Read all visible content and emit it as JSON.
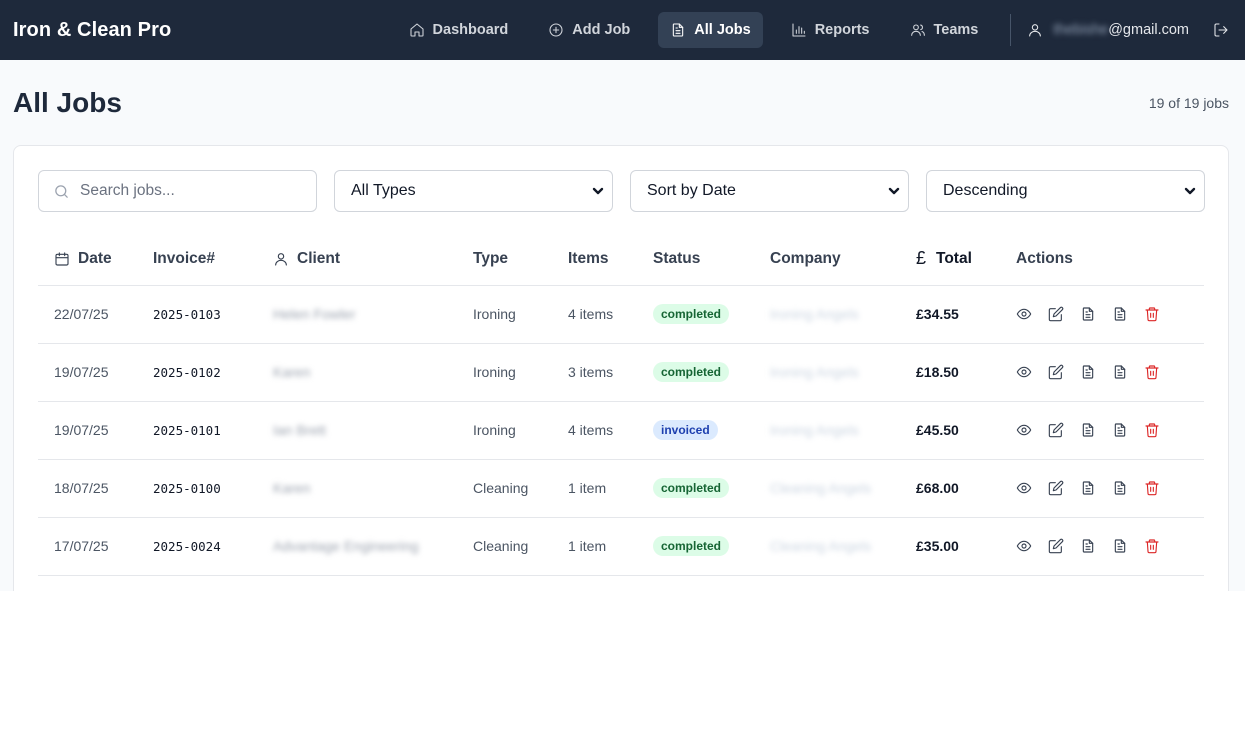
{
  "app": {
    "brand": "Iron & Clean Pro"
  },
  "nav": [
    {
      "label": "Dashboard",
      "icon": "home-icon",
      "active": false
    },
    {
      "label": "Add Job",
      "icon": "plus-circle-icon",
      "active": false
    },
    {
      "label": "All Jobs",
      "icon": "document-icon",
      "active": true
    },
    {
      "label": "Reports",
      "icon": "bar-chart-icon",
      "active": false
    },
    {
      "label": "Teams",
      "icon": "users-icon",
      "active": false
    }
  ],
  "user": {
    "name_hidden": "thebishe",
    "email_domain": "@gmail.com"
  },
  "page": {
    "title": "All Jobs",
    "count": "19 of 19 jobs"
  },
  "filters": {
    "search_placeholder": "Search jobs...",
    "type": "All Types",
    "sort": "Sort by Date",
    "order": "Descending"
  },
  "table": {
    "headers": {
      "date": "Date",
      "invoice": "Invoice#",
      "client": "Client",
      "type": "Type",
      "items": "Items",
      "status": "Status",
      "company": "Company",
      "total": "Total",
      "actions": "Actions"
    },
    "rows": [
      {
        "date": "22/07/25",
        "invoice": "2025-0103",
        "client": "Helen Fowler",
        "type": "Ironing",
        "items": "4 items",
        "status": "completed",
        "company": "Ironing Angels",
        "total": "£34.55"
      },
      {
        "date": "19/07/25",
        "invoice": "2025-0102",
        "client": "Karen",
        "type": "Ironing",
        "items": "3 items",
        "status": "completed",
        "company": "Ironing Angels",
        "total": "£18.50"
      },
      {
        "date": "19/07/25",
        "invoice": "2025-0101",
        "client": "Ian Brett",
        "type": "Ironing",
        "items": "4 items",
        "status": "invoiced",
        "company": "Ironing Angels",
        "total": "£45.50"
      },
      {
        "date": "18/07/25",
        "invoice": "2025-0100",
        "client": "Karen",
        "type": "Cleaning",
        "items": "1 item",
        "status": "completed",
        "company": "Cleaning Angels",
        "total": "£68.00"
      },
      {
        "date": "17/07/25",
        "invoice": "2025-0024",
        "client": "Advantage Engineering",
        "type": "Cleaning",
        "items": "1 item",
        "status": "completed",
        "company": "Cleaning Angels",
        "total": "£35.00"
      }
    ]
  },
  "colors": {
    "topbar": "#1e293b",
    "active_nav": "#334155",
    "completed_bg": "#dcfce7",
    "invoiced_bg": "#dbeafe",
    "delete": "#dc2626"
  }
}
